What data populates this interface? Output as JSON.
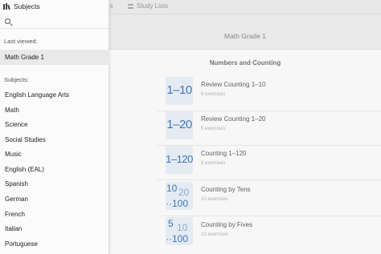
{
  "topbar": {
    "exercises_partial": "es",
    "study_lists": "Study Lists"
  },
  "main": {
    "grade_title": "Math Grade 1",
    "section_title": "Numbers and Counting",
    "exercises": [
      {
        "title": "Review Counting 1–10",
        "count": "6 exercises",
        "thumb": "1–10"
      },
      {
        "title": "Review Counting 1–20",
        "count": "5 exercises",
        "thumb": "1–20"
      },
      {
        "title": "Counting 1–120",
        "count": "8 exercises",
        "thumb": "1–120"
      },
      {
        "title": "Counting by Tens",
        "count": "10 exercises",
        "thumb_a": "10",
        "thumb_b": "20",
        "thumb_c": "··100"
      },
      {
        "title": "Counting by Fives",
        "count": "10 exercises",
        "thumb_a": "5",
        "thumb_b": "10",
        "thumb_c": "··100"
      }
    ]
  },
  "drawer": {
    "title": "Subjects",
    "search_placeholder": "",
    "last_viewed_label": "Last viewed:",
    "last_viewed_item": "Math Grade 1",
    "subjects_label": "Subjects:",
    "subjects": [
      "English Language Arts",
      "Math",
      "Science",
      "Social Studies",
      "Music",
      "English (EAL)",
      "Spanish",
      "German",
      "French",
      "Italian",
      "Portuguese"
    ]
  },
  "colors": {
    "accent": "#3e7ac6",
    "thumb_bg": "#edf3fa",
    "selected_bg": "#e9e9e9"
  }
}
